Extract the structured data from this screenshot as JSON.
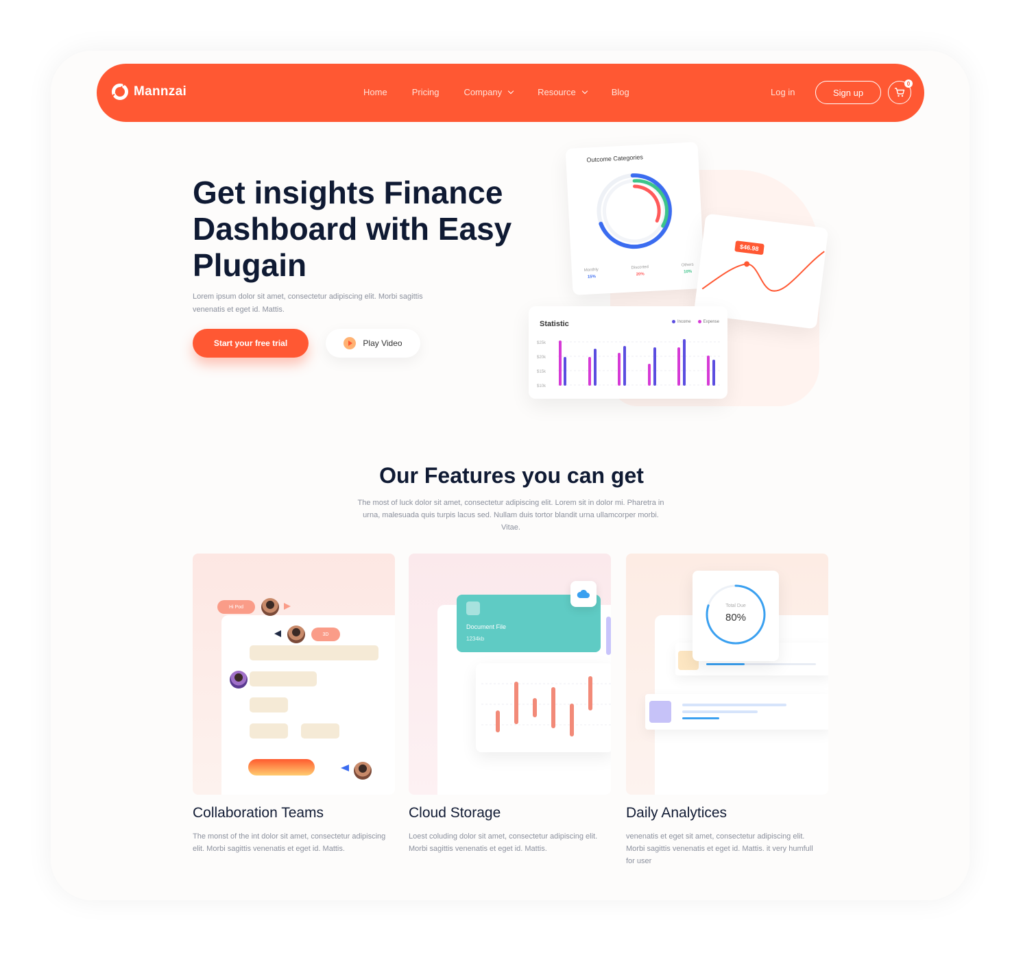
{
  "nav": {
    "brand": "Mannzai",
    "links": [
      {
        "label": "Home",
        "dropdown": false
      },
      {
        "label": "Pricing",
        "dropdown": false
      },
      {
        "label": "Company",
        "dropdown": true
      },
      {
        "label": "Resource",
        "dropdown": true
      },
      {
        "label": "Blog",
        "dropdown": false
      }
    ],
    "login": "Log in",
    "signup": "Sign up",
    "cart_count": "0",
    "accent_color": "#ff5833"
  },
  "hero": {
    "title": "Get insights Finance Dashboard with Easy Plugain",
    "subtitle": "Lorem ipsum dolor sit amet, consectetur adipiscing elit. Morbi sagittis venenatis et eget id. Mattis.",
    "cta": "Start your free trial",
    "play": "Play Video"
  },
  "illustration": {
    "outcome_title": "Outcome Categories",
    "outcome_legend": [
      {
        "label": "Monthly",
        "value": "15%",
        "color": "#3b6cf0"
      },
      {
        "label": "Discorted",
        "value": "20%",
        "color": "#ff5a5a"
      },
      {
        "label": "Others",
        "value": "10%",
        "color": "#3cc48a"
      }
    ],
    "price_tag": "$46.98",
    "stat_title": "Statistic",
    "stat_legend": [
      {
        "label": "Income",
        "color": "#5b4de0"
      },
      {
        "label": "Expense",
        "color": "#d63ad6"
      }
    ],
    "stat_y_ticks": [
      "$25k",
      "$20k",
      "$15k",
      "$10k"
    ]
  },
  "features": {
    "title": "Our Features you can get",
    "subtitle": "The most of luck dolor sit amet, consectetur adipiscing elit. Lorem sit in dolor mi. Pharetra in urna, malesuada quis turpis lacus sed. Nullam duis tortor blandit urna ullamcorper morbi. Vitae.",
    "items": [
      {
        "name": "Collaboration Teams",
        "desc": "The monst of the int dolor sit amet, consectetur adipiscing elit. Morbi sagittis venenatis et eget id. Mattis.",
        "tags": [
          "Hi Pod",
          "3D"
        ]
      },
      {
        "name": "Cloud Storage",
        "desc": "Loest coluding dolor sit amet, consectetur adipiscing elit. Morbi sagittis venenatis et eget id. Mattis.",
        "doc_title": "Document File",
        "doc_size": "1234kb"
      },
      {
        "name": "Daily Analytices",
        "desc": "venenatis et eget sit amet, consectetur adipiscing elit. Morbi sagittis venenatis et eget id. Mattis. it very humfull for user",
        "gauge_label": "Total Due",
        "gauge_value": "80%",
        "gauge_fraction": 0.8
      }
    ]
  }
}
